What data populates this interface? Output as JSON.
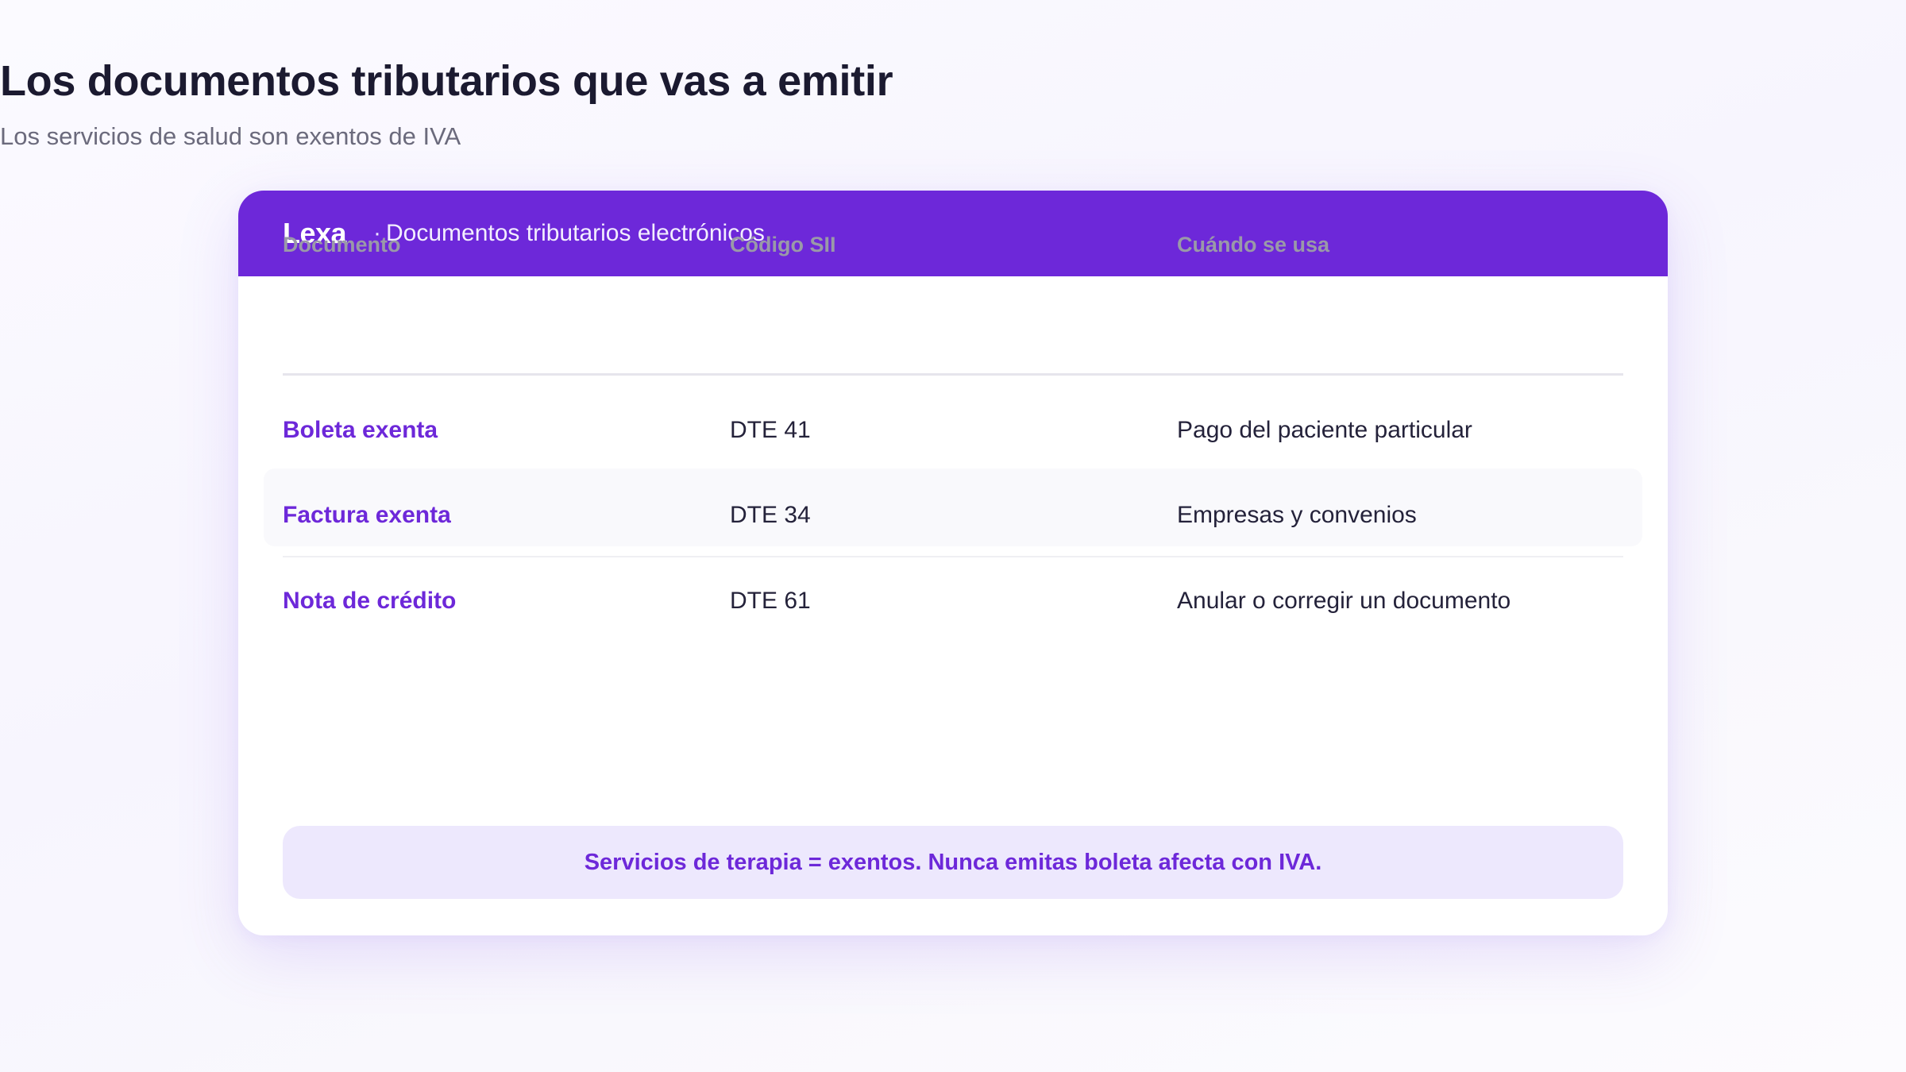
{
  "page": {
    "title": "Los documentos tributarios que vas a emitir",
    "subtitle": "Los servicios de salud son exentos de IVA"
  },
  "card": {
    "brand": "Lexa",
    "separator": "·",
    "description": "Documentos tributarios electrónicos"
  },
  "table": {
    "headers": [
      "Documento",
      "Código SII",
      "Cuándo se usa"
    ],
    "rows": [
      {
        "document": "Boleta exenta",
        "code": "DTE 41",
        "usage": "Pago del paciente particular"
      },
      {
        "document": "Factura exenta",
        "code": "DTE 34",
        "usage": "Empresas y convenios"
      },
      {
        "document": "Nota de crédito",
        "code": "DTE 61",
        "usage": "Anular o corregir un documento"
      }
    ]
  },
  "note": "Servicios de terapia = exentos. Nunca emitas boleta afecta con IVA.",
  "colors": {
    "accent": "#6d28d9",
    "note_background": "#ede8fd",
    "title": "#1b1a30",
    "muted": "#9a99a8"
  }
}
